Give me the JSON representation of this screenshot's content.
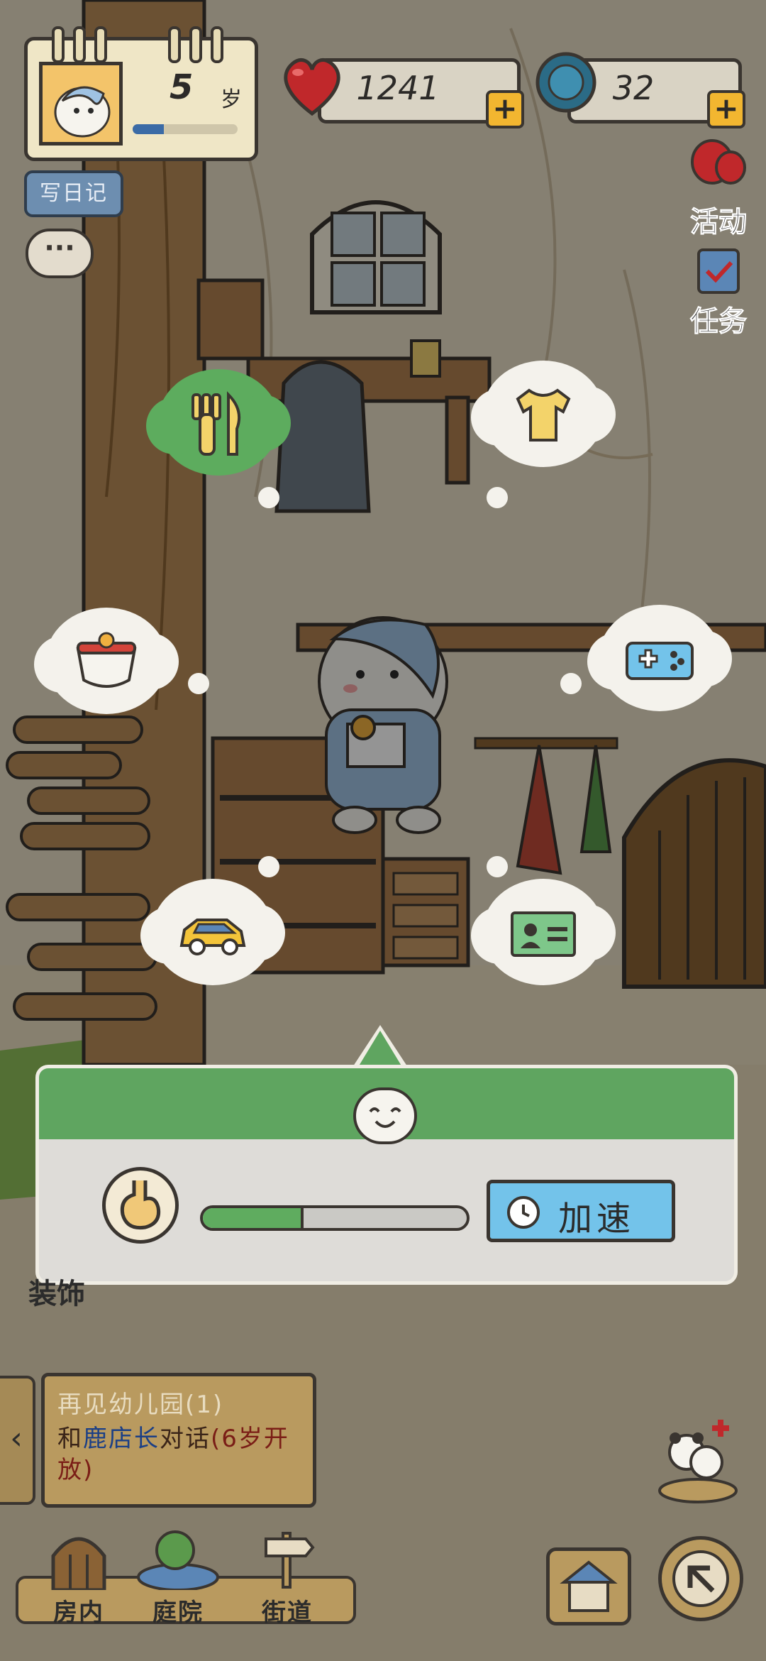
{
  "profile": {
    "age_number": "5",
    "age_unit": "岁",
    "age_progress": 0.3
  },
  "stats": {
    "hearts": "1241",
    "coins": "32",
    "add_symbol": "+"
  },
  "left_buttons": {
    "diary": "写日记",
    "chat": "···"
  },
  "right_buttons": {
    "events": "活动",
    "tasks": "任务"
  },
  "actions": [
    {
      "name": "eat",
      "icon": "fork-knife-icon",
      "active": true
    },
    {
      "name": "clothes",
      "icon": "tshirt-icon",
      "active": false
    },
    {
      "name": "bathe",
      "icon": "bathtub-icon",
      "active": false
    },
    {
      "name": "play",
      "icon": "gamepad-icon",
      "active": false
    },
    {
      "name": "travel",
      "icon": "car-icon",
      "active": false
    },
    {
      "name": "id-card",
      "icon": "id-card-icon",
      "active": false
    }
  ],
  "panel": {
    "progress": 0.37,
    "speed_up_label": "加速",
    "status_icon": "stomach-icon"
  },
  "decor_label": "装饰",
  "quest": {
    "title": "再见幼儿园(1)",
    "desc_prefix": "和",
    "desc_npc": "鹿店长",
    "desc_middle": "对话",
    "desc_suffix": "(6岁开放)",
    "arrow": "‹"
  },
  "nav": {
    "room": "房内",
    "yard": "庭院",
    "street": "街道"
  },
  "colors": {
    "accent_green": "#5fa560",
    "speed_blue": "#73c3ea",
    "heart_red": "#c0282b"
  }
}
